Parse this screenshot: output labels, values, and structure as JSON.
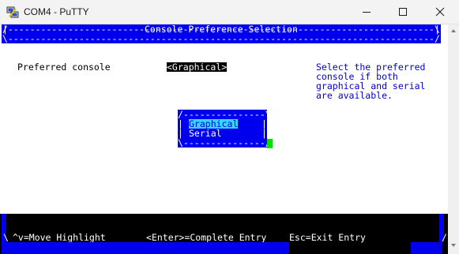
{
  "window": {
    "title": "COM4 - PuTTY"
  },
  "screen": {
    "header_border_top": "/------------------------------------------------------------------------------\\",
    "header_title_line": "|                         Console Preference Selection                         |",
    "header_border_bottom": "\\------------------------------------------------------------------------------/",
    "field_label": "Preferred console",
    "field_value": "<Graphical>",
    "help_lines": [
      "Select the preferred",
      "console if both",
      "graphical and serial",
      "are available."
    ],
    "popup": {
      "border_top": "/---------------\\",
      "options": [
        "Graphical",
        "Serial"
      ],
      "selected_index": 0,
      "border_bottom": "\\---------------/"
    },
    "footer": {
      "left_edge": "\\",
      "right_edge": "/",
      "hint_move": "^v=Move Highlight",
      "hint_enter": "<Enter>=Complete Entry",
      "hint_esc": "Esc=Exit Entry"
    }
  },
  "colors": {
    "terminal_blue": "#0000ee",
    "highlight_cyan": "#36d7ff",
    "cursor_green": "#00e000",
    "help_text_blue": "#0000cc"
  },
  "icons": [
    "putty-icon",
    "minimize-icon",
    "maximize-icon",
    "close-icon",
    "scroll-up-icon",
    "scroll-down-icon"
  ]
}
